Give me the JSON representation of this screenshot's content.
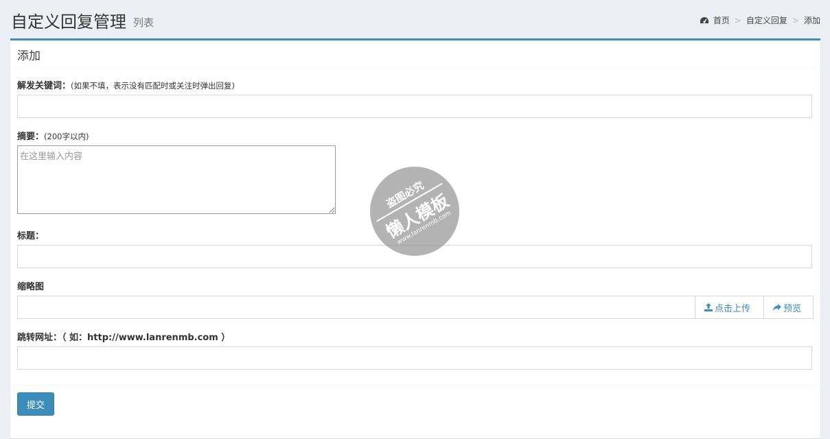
{
  "header": {
    "title": "自定义回复管理",
    "subtitle": "列表",
    "breadcrumb": [
      {
        "label": "首页",
        "icon": "dashboard-icon"
      },
      {
        "label": "自定义回复"
      },
      {
        "label": "添加"
      }
    ],
    "breadcrumb_separator": ">"
  },
  "box": {
    "title": "添加",
    "accent_color": "#3c8dbc"
  },
  "form": {
    "keyword": {
      "label": "解发关键词：",
      "hint": "(如果不填，表示没有匹配时或关注时弹出回复)",
      "value": ""
    },
    "summary": {
      "label": "摘要：",
      "hint": "(200字以内)",
      "placeholder": "在这里输入内容",
      "value": ""
    },
    "title": {
      "label": "标题：",
      "value": ""
    },
    "thumbnail": {
      "label": "缩略图",
      "value": "",
      "upload_label": "点击上传",
      "upload_icon": "upload-icon",
      "preview_label": "预览",
      "preview_icon": "share-arrow-icon"
    },
    "redirect": {
      "label": "跳转网址：（ 如：http://www.lanrenmb.com ）",
      "value": ""
    },
    "submit_label": "提交"
  },
  "watermark": {
    "top_text": "盗图必究",
    "main_text": "懒人模板",
    "url_text": "www.lanrenmb.com"
  }
}
